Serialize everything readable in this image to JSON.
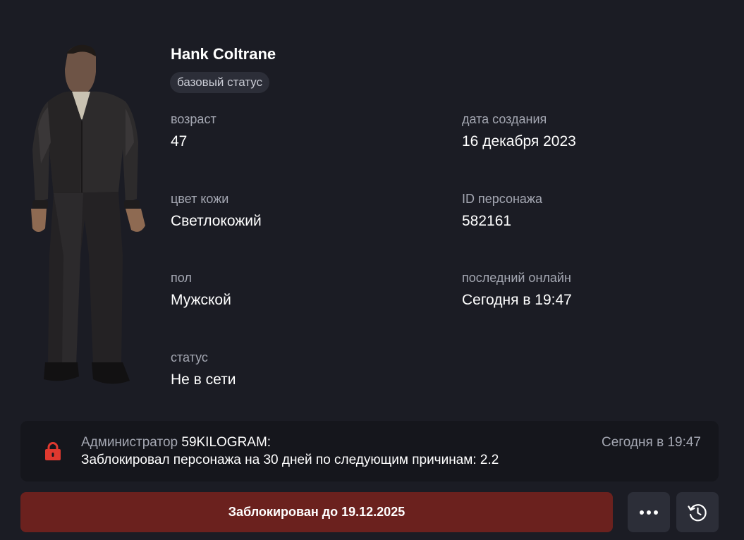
{
  "profile": {
    "name": "Hank Coltrane",
    "status_badge": "базовый статус"
  },
  "fields": {
    "age": {
      "label": "возраст",
      "value": "47"
    },
    "created": {
      "label": "дата создания",
      "value": "16 декабря 2023"
    },
    "skin": {
      "label": "цвет кожи",
      "value": "Светлокожий"
    },
    "character_id": {
      "label": "ID персонажа",
      "value": "582161"
    },
    "gender": {
      "label": "пол",
      "value": "Мужской"
    },
    "last_online": {
      "label": "последний онлайн",
      "value": "Сегодня в 19:47"
    },
    "status": {
      "label": "статус",
      "value": "Не в сети"
    }
  },
  "notice": {
    "icon": "lock-icon",
    "role": "Администратор",
    "admin": "59KILOGRAM:",
    "message": "Заблокировал персонажа на 30 дней по следующим причинам: 2.2",
    "time": "Сегодня в 19:47"
  },
  "actions": {
    "blocked_label": "Заблокирован до 19.12.2025",
    "more_icon": "more-dots-icon",
    "history_icon": "history-clock-icon"
  },
  "colors": {
    "background": "#1b1c24",
    "notice_bg": "#15161c",
    "blocked_bg": "#6b211e",
    "lock_red": "#e0392f",
    "muted_text": "#a4a7b2"
  }
}
